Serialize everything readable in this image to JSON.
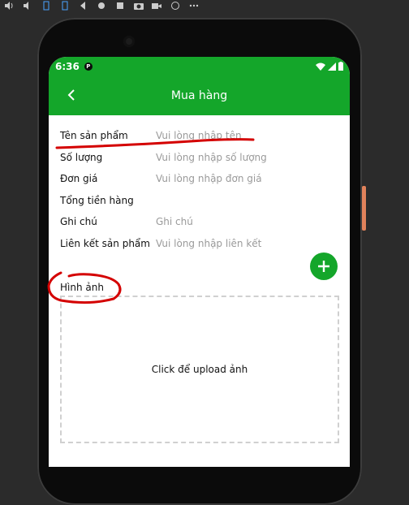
{
  "status": {
    "time": "6:36",
    "app_badge": "P"
  },
  "app": {
    "title": "Mua hàng"
  },
  "form": {
    "fields": [
      {
        "label": "Tên sản phẩm",
        "placeholder": "Vui lòng nhập tên"
      },
      {
        "label": "Số lượng",
        "placeholder": "Vui lòng nhập số lượng"
      },
      {
        "label": "Đơn giá",
        "placeholder": "Vui lòng nhập đơn giá"
      },
      {
        "label": "Tổng tiền hàng",
        "placeholder": ""
      },
      {
        "label": "Ghi chú",
        "placeholder": "Ghi chú"
      },
      {
        "label": "Liên kết sản phẩm",
        "placeholder": "Vui lòng nhập liên kết"
      }
    ],
    "image_label": "Hình ảnh",
    "upload_text": "Click để upload ảnh"
  },
  "colors": {
    "primary": "#14a62a",
    "annotation": "#d40000"
  },
  "icons": [
    "volume-icon",
    "volume-down-icon",
    "rotate-left-icon",
    "rotate-right-icon",
    "back-icon",
    "home-icon",
    "overview-icon",
    "camera-icon",
    "video-icon",
    "rewind-icon",
    "more-icon",
    "back-arrow-icon",
    "plus-icon",
    "wifi-icon",
    "signal-icon",
    "battery-icon"
  ]
}
